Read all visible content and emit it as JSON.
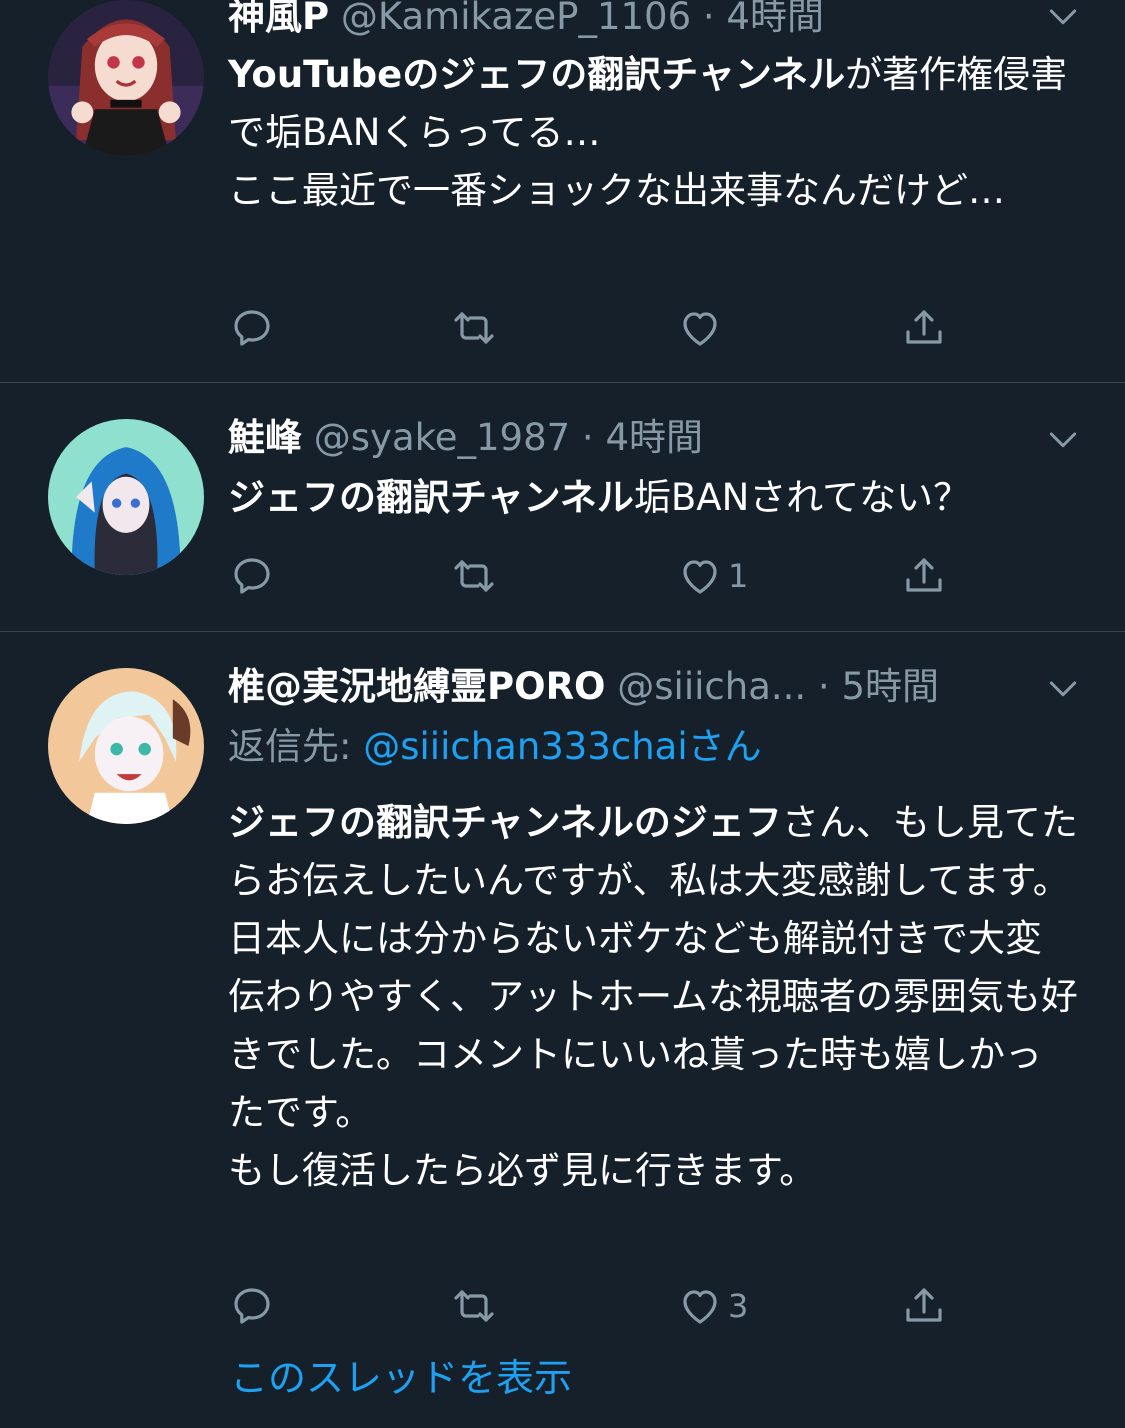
{
  "colors": {
    "background": "#15202b",
    "muted": "#8899a6",
    "link": "#1da1f2",
    "divider": "#38444d"
  },
  "tweets": [
    {
      "name": "神風P",
      "handle": "@KamikazeP_1106",
      "sep": "·",
      "time": "4時間",
      "body_bold": "YouTubeのジェフの翻訳チャンネル",
      "body_rest": "が著作権侵害で垢BANくらってる…\nここ最近で一番ショックな出来事なんだけど…",
      "likes": ""
    },
    {
      "name": "鮭峰",
      "handle": "@syake_1987",
      "sep": "·",
      "time": "4時間",
      "body_bold": "ジェフの翻訳チャンネル",
      "body_rest": "垢BANされてない？",
      "likes": "1"
    },
    {
      "name": "椎@実況地縛霊PORO",
      "handle": "@siiicha...",
      "sep": "·",
      "time": "5時間",
      "reply_prefix": "返信先: ",
      "reply_handle": "@siiichan333chai",
      "reply_suffix": "さん",
      "body_bold": "ジェフの翻訳チャンネルのジェフ",
      "body_rest": "さん、もし見てたらお伝えしたいんですが、私は大変感謝してます。\n日本人には分からないボケなども解説付きで大変伝わりやすく、アットホームな視聴者の雰囲気も好きでした。コメントにいいね貰った時も嬉しかったです。\nもし復活したら必ず見に行きます。",
      "likes": "3"
    }
  ],
  "show_thread": "このスレッドを表示",
  "icons": [
    "reply-icon",
    "retweet-icon",
    "like-icon",
    "share-icon",
    "chevron-down-icon"
  ]
}
